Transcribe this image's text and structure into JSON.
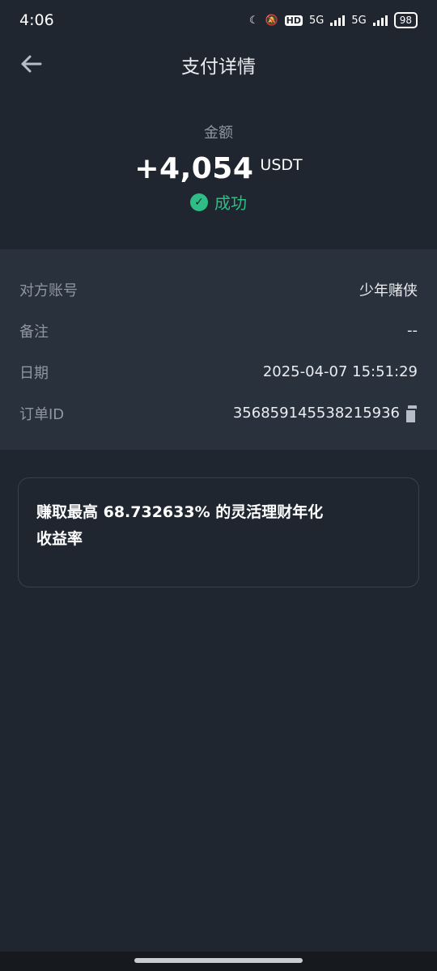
{
  "status_bar": {
    "time": "4:06",
    "hd_label": "HD",
    "net1": "5G",
    "net2": "5G",
    "battery": "98"
  },
  "header": {
    "title": "支付详情",
    "back_icon": "arrow-left-icon"
  },
  "amount": {
    "label": "金额",
    "value": "+4,054",
    "unit": "USDT",
    "status": "成功",
    "status_color": "#2ebd85"
  },
  "details": [
    {
      "label": "对方账号",
      "value": "少年赌侠"
    },
    {
      "label": "备注",
      "value": "--"
    },
    {
      "label": "日期",
      "value": "2025-04-07 15:51:29"
    },
    {
      "label": "订单ID",
      "value": "356859145538215936"
    }
  ],
  "promo": {
    "text": "赚取最高 68.732633% 的灵活理财年化收益率"
  },
  "colors": {
    "background": "#1f2630",
    "panel": "#29313d",
    "accent_green": "#2ebd85"
  }
}
